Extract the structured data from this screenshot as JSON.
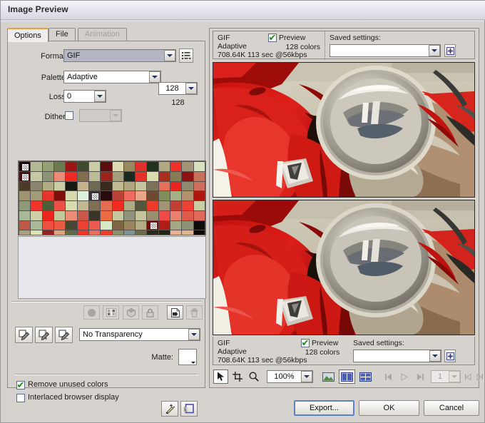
{
  "window": {
    "title": "Image Preview"
  },
  "tabs": [
    {
      "label": "Options",
      "state": "active"
    },
    {
      "label": "File",
      "state": "normal"
    },
    {
      "label": "Animation",
      "state": "disabled"
    }
  ],
  "options": {
    "format": {
      "label": "Format:",
      "value": "GIF"
    },
    "palette": {
      "label": "Palette:",
      "value": "Adaptive"
    },
    "loss": {
      "label": "Loss:",
      "value": "0"
    },
    "dither": {
      "label": "Dither:",
      "checked": false,
      "value": ""
    },
    "colors": {
      "value": "128",
      "readout": "128"
    },
    "transparency": {
      "value": "No Transparency"
    },
    "matte": {
      "label": "Matte:",
      "color": "#ffffff"
    },
    "remove_unused_colors": {
      "label": "Remove unused colors",
      "checked": true
    },
    "interlaced": {
      "label": "Interlaced browser display",
      "checked": false
    }
  },
  "palette_swatches": [
    "#1a0707",
    "#b3b897",
    "#95a075",
    "#6b7a50",
    "#9d1414",
    "#3f4a2c",
    "#cbcda4",
    "#5d0c0c",
    "#dbdcb0",
    "#97885e",
    "#e0322a",
    "#22301e",
    "#b2a884",
    "#f03127",
    "#a39478",
    "#d9e0c0",
    "#4a0d0d",
    "#c5c9a4",
    "#8b9474",
    "#eb8a78",
    "#ef2a22",
    "#836d4c",
    "#b9bd94",
    "#9a241c",
    "#a49e7c",
    "#1c2a1e",
    "#e4322a",
    "#d9dcae",
    "#a92e26",
    "#8a7a58",
    "#8f1312",
    "#c9705e",
    "#4b3a28",
    "#8c8670",
    "#b2ab84",
    "#c9cfa4",
    "#171a12",
    "#c3b28c",
    "#6f6a54",
    "#3a2b1c",
    "#c0bb90",
    "#b0a57e",
    "#c6c49c",
    "#7d725a",
    "#e4705a",
    "#e8251e",
    "#8f8a6e",
    "#cf6f5a",
    "#9e9570",
    "#a49c78",
    "#e6352c",
    "#7e0f0f",
    "#d6d9ae",
    "#ddf0dc",
    "#3a3238",
    "#2a0b0b",
    "#ba4337",
    "#ef6a60",
    "#e8a58c",
    "#6e4a34",
    "#7f8e5c",
    "#a8b088",
    "#b5906e",
    "#b01512",
    "#8e9a76",
    "#f0342b",
    "#4c6038",
    "#ea5043",
    "#d9dcab",
    "#c2b78e",
    "#7e7050",
    "#e26e4f",
    "#ef2b22",
    "#b0aa82",
    "#53583a",
    "#ec3a2c",
    "#a09474",
    "#c24034",
    "#ee4034",
    "#c9ce9e",
    "#a8b898",
    "#cdd0a6",
    "#ee241e",
    "#c2c89c",
    "#ec8d78",
    "#c8594a",
    "#3a3424",
    "#ea6a42",
    "#c4c89c",
    "#8e9478",
    "#c4c39a",
    "#9a8e70",
    "#ef4a48",
    "#ea8070",
    "#e25a4a",
    "#e2685a",
    "#c05a44",
    "#aab89a",
    "#f05040",
    "#ec5a44",
    "#4a4634",
    "#ef4034",
    "#ef5a4e",
    "#d8e8c4",
    "#7e6442",
    "#9b8462",
    "#b4ac84",
    "#6e0c0c",
    "#b01c18",
    "#a3a984",
    "#8c9274",
    "#0c0c0c",
    "#a8a07e",
    "#dde0b0",
    "#942220",
    "#d9a67e",
    "#5e6b46",
    "#ef3428",
    "#ef6a58",
    "#ef3a2e",
    "#8c9268",
    "#7e9494",
    "#6e6a4a",
    "#2a2a1c",
    "#222218",
    "#e8b28e",
    "#e0b48e",
    "#120a06"
  ],
  "palette_marked_indices": [
    0,
    16,
    54,
    107
  ],
  "palette_buttons": [
    {
      "name": "edit-color",
      "glyph": "circle"
    },
    {
      "name": "web-safe",
      "glyph": "websafe"
    },
    {
      "name": "transparent-color",
      "glyph": "cube"
    },
    {
      "name": "lock-color",
      "glyph": "lock"
    },
    {
      "name": "add-color",
      "glyph": "newpage"
    },
    {
      "name": "delete-color",
      "glyph": "trash"
    }
  ],
  "eyedroppers": [
    {
      "name": "select-transparent-color"
    },
    {
      "name": "add-to-transparency"
    },
    {
      "name": "remove-from-transparency"
    }
  ],
  "preview_top": {
    "format": "GIF",
    "palette": "Adaptive",
    "stats": "708.64K  113 sec @56kbps",
    "preview_label": "Preview",
    "preview_checked": true,
    "colors": "128 colors",
    "saved_settings_label": "Saved settings:",
    "saved_settings_value": ""
  },
  "preview_bottom": {
    "format": "GIF",
    "palette": "Adaptive",
    "stats": "708.64K  113 sec @56kbps",
    "preview_label": "Preview",
    "preview_checked": true,
    "colors": "128 colors",
    "saved_settings_label": "Saved settings:",
    "saved_settings_value": ""
  },
  "toolbar": {
    "zoom_value": "100%",
    "frame_value": "1",
    "tools": [
      {
        "name": "pointer-tool",
        "active": true
      },
      {
        "name": "crop-tool",
        "active": false
      },
      {
        "name": "zoom-tool",
        "active": false
      }
    ],
    "view_modes": [
      {
        "name": "single-view-button",
        "active": false
      },
      {
        "name": "two-up-view-button",
        "active": true
      },
      {
        "name": "four-up-view-button",
        "active": false
      }
    ],
    "playback": [
      {
        "name": "first-frame-button"
      },
      {
        "name": "play-button"
      },
      {
        "name": "last-frame-button"
      },
      {
        "name": "prev-frame-button"
      },
      {
        "name": "next-frame-button"
      }
    ]
  },
  "buttons": {
    "export": "Export...",
    "ok": "OK",
    "cancel": "Cancel"
  }
}
